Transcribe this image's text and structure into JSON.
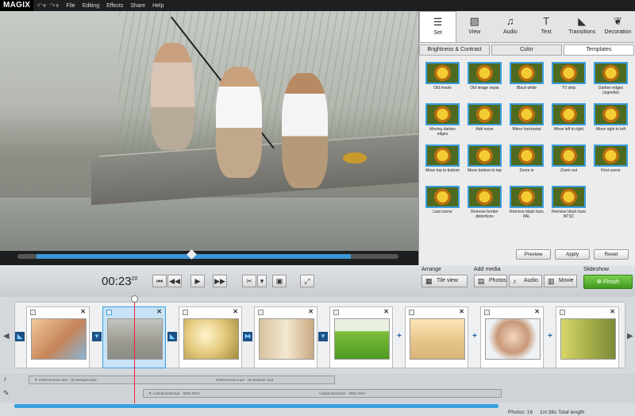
{
  "app": {
    "logo": "MAGIX"
  },
  "menu": [
    "File",
    "Editing",
    "Effects",
    "Share",
    "Help"
  ],
  "tabs": [
    {
      "label": "Set",
      "icon": "set-icon",
      "active": true
    },
    {
      "label": "View",
      "icon": "view-icon"
    },
    {
      "label": "Audio",
      "icon": "audio-note-icon"
    },
    {
      "label": "Text",
      "icon": "text-icon"
    },
    {
      "label": "Transitions",
      "icon": "transitions-icon"
    },
    {
      "label": "Decoration",
      "icon": "decoration-icon"
    }
  ],
  "subtabs": [
    "Brightness & Contrast",
    "Color",
    "Templates"
  ],
  "templates": [
    "Old movie",
    "Old image sepia",
    "Black white",
    "TV strip",
    "Darken edges (vignette)",
    "Moving darken edges",
    "Add noise",
    "Mirror horizontal",
    "Move left to right",
    "Move right to left",
    "Move top to bottom",
    "Move bottom to top",
    "Zoom in",
    "Zoom out",
    "First scene",
    "Last scene",
    "Remove border distortions",
    "Remove black bars PAL",
    "Remove black bars NTSC"
  ],
  "panel_buttons": {
    "preview": "Preview",
    "apply": "Apply",
    "reset": "Reset"
  },
  "transport": {
    "time_main": "00:23",
    "time_frames": "20"
  },
  "arrange": {
    "label": "Arrange",
    "tile_view": "Tile view"
  },
  "add_media": {
    "label": "Add media",
    "photos": "Photos",
    "audio": "Audio",
    "movie": "Movie"
  },
  "slideshow": {
    "label": "Slideshow",
    "finish": "Finish"
  },
  "audio_tracks": {
    "track1_a": "▼ SOE(Hmovie.mp3  ·  (€) Beispiel.mp3",
    "track1_b": "SOE(Hmovie.mp3  ·  (€) Beispiel.mp3",
    "track2_a": "▼ Audiokommentar  ·  0001.WAV",
    "track2_b": "Audiokommentar  ·  0001.WAV"
  },
  "status": {
    "photos": "Photos: 16",
    "length": "1m:38s Total length"
  },
  "colors": {
    "accent": "#3a9ee0",
    "finish": "#5fb832",
    "menubar": "#1e1f21"
  }
}
